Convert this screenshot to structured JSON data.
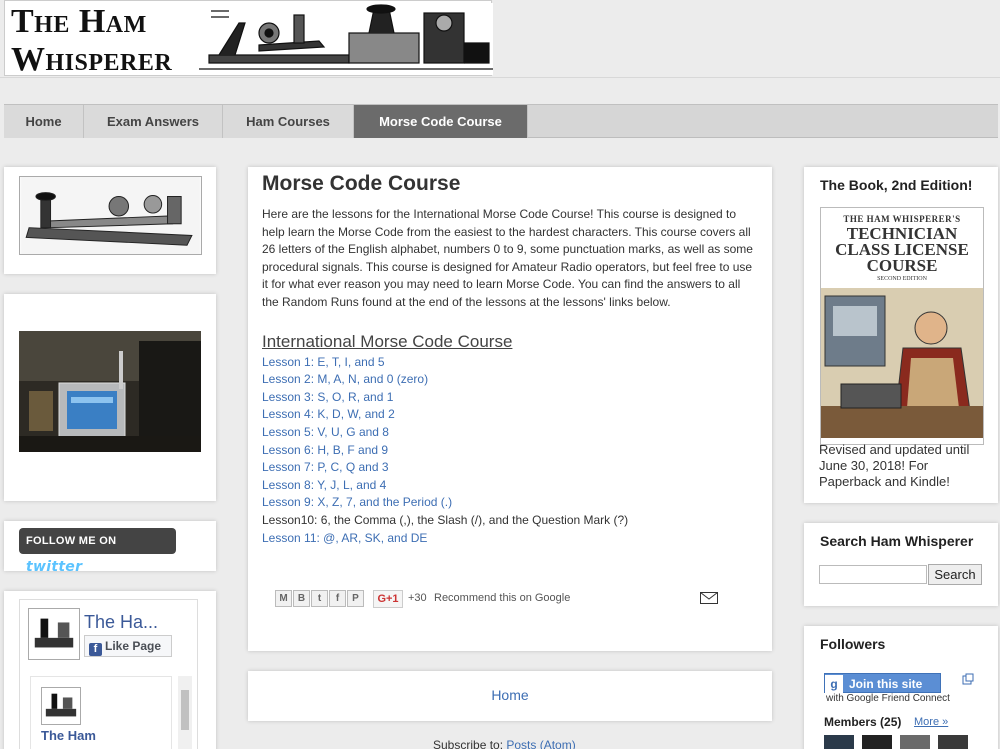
{
  "header": {
    "logo_line1": "The Ham",
    "logo_line2": "Whisperer"
  },
  "nav": {
    "tabs": [
      {
        "label": "Home",
        "active": false
      },
      {
        "label": "Exam Answers",
        "active": false
      },
      {
        "label": "Ham Courses",
        "active": false
      },
      {
        "label": "Morse Code Course",
        "active": true
      }
    ]
  },
  "post": {
    "title": "Morse Code Course",
    "intro": "Here are the lessons for the International Morse Code Course!  This course is designed to help learn the Morse Code from the easiest to the hardest characters.  This course covers all 26 letters of the English alphabet, numbers 0 to 9, some punctuation marks, as well as some procedural signals.  This course is designed for Amateur Radio operators, but feel free to use it for what ever reason you may need to learn Morse Code.  You can find the answers to all the Random Runs found at the end of the lessons at the lessons' links below.",
    "course_heading": "International Morse Code Course",
    "lessons": [
      "Lesson 1: E, T, I, and 5",
      "Lesson 2: M, A, N, and 0 (zero)",
      "Lesson 3: S, O, R, and 1",
      "Lesson 4: K, D, W, and 2",
      "Lesson 5: V, U, G and 8",
      "Lesson 6: H, B, F and 9",
      "Lesson 7: P, C, Q and 3",
      "Lesson 8: Y, J, L, and 4",
      "Lesson 9: X, Z, 7, and the Period (.)",
      "Lesson10: 6, the Comma (,), the Slash (/), and the Question Mark (?)",
      "Lesson 11: @, AR, SK, and DE"
    ],
    "share": {
      "buttons": [
        "M",
        "B",
        "t",
        "f",
        "P"
      ],
      "gplus_label": "G+1",
      "gplus_count": "+30",
      "recommend_text": "Recommend this on Google"
    }
  },
  "pager": {
    "home_label": "Home",
    "subscribe_text": "Subscribe to: ",
    "subscribe_link": "Posts (Atom)"
  },
  "left": {
    "twitter_label": "FOLLOW ME ON ",
    "twitter_brand": "twitter",
    "fb_page_name": "The Ha...",
    "fb_like_label": "Like Page",
    "fb_feed_name": "The Ham"
  },
  "right": {
    "book_title": "The Book, 2nd Edition!",
    "book_cover_line1": "THE HAM WHISPERER'S",
    "book_cover_line2": "TECHNICIAN CLASS LICENSE COURSE",
    "book_cover_line3": "SECOND EDITION",
    "book_caption": "Revised and updated until June 30, 2018! For Paperback and Kindle!",
    "search_title": "Search Ham Whisperer",
    "search_value": "",
    "search_button": "Search",
    "followers_title": "Followers",
    "join_label": "Join this site",
    "gfc_label": "with Google Friend Connect",
    "members_label": "Members (25)",
    "more_label": "More »"
  },
  "colors": {
    "link": "#3d6eb3",
    "active_tab": "#6b6b6b",
    "background": "#ececec"
  }
}
